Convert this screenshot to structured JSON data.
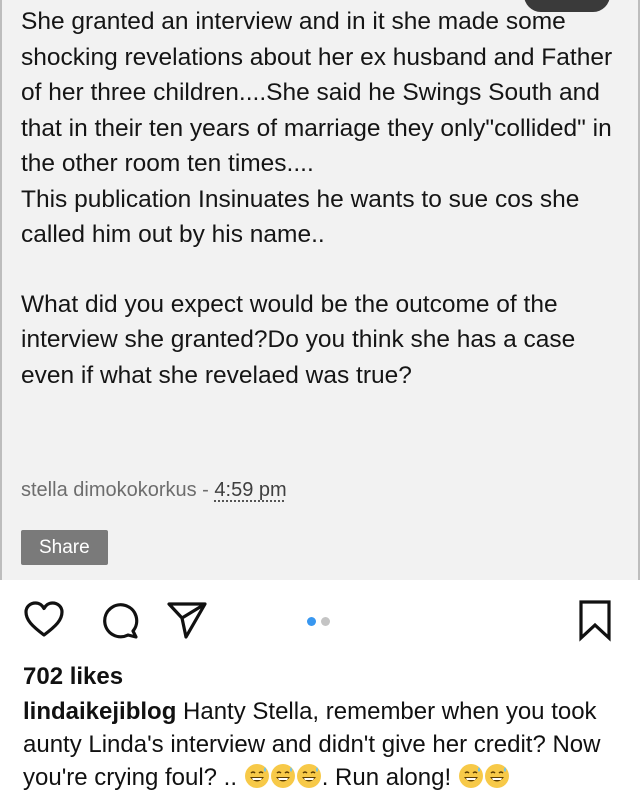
{
  "post": {
    "paragraph1": "She granted an interview and in it she made some shocking revelations about her ex husband and Father of her three children....She said he Swings South   and that in their ten years of marriage they only\"collided\" in the other room ten times....",
    "paragraph2": "This publication Insinuates he wants to sue cos she called him out by his name..",
    "paragraph3": "What did you expect would be the outcome of the interview she granted?Do you think she has a case even if what she revelaed was true?",
    "author": "stella dimokokorkus",
    "separator": " - ",
    "time": "4:59 pm",
    "share_label": "Share"
  },
  "actions": {
    "like_icon": "heart-outline-icon",
    "comment_icon": "comment-bubble-icon",
    "share_icon": "paper-plane-icon",
    "save_icon": "bookmark-outline-icon",
    "carousel_total": 2,
    "carousel_active": 1,
    "active_dot_color": "#3897f0",
    "inactive_dot_color": "#c4c4c4"
  },
  "likes": "702 likes",
  "caption": {
    "username": "lindaikejiblog",
    "text_part1": " Hanty Stella, remember when you took aunty Linda's interview and didn't give her credit? Now you're crying foul? .. ",
    "text_part2": ". Run along! "
  }
}
